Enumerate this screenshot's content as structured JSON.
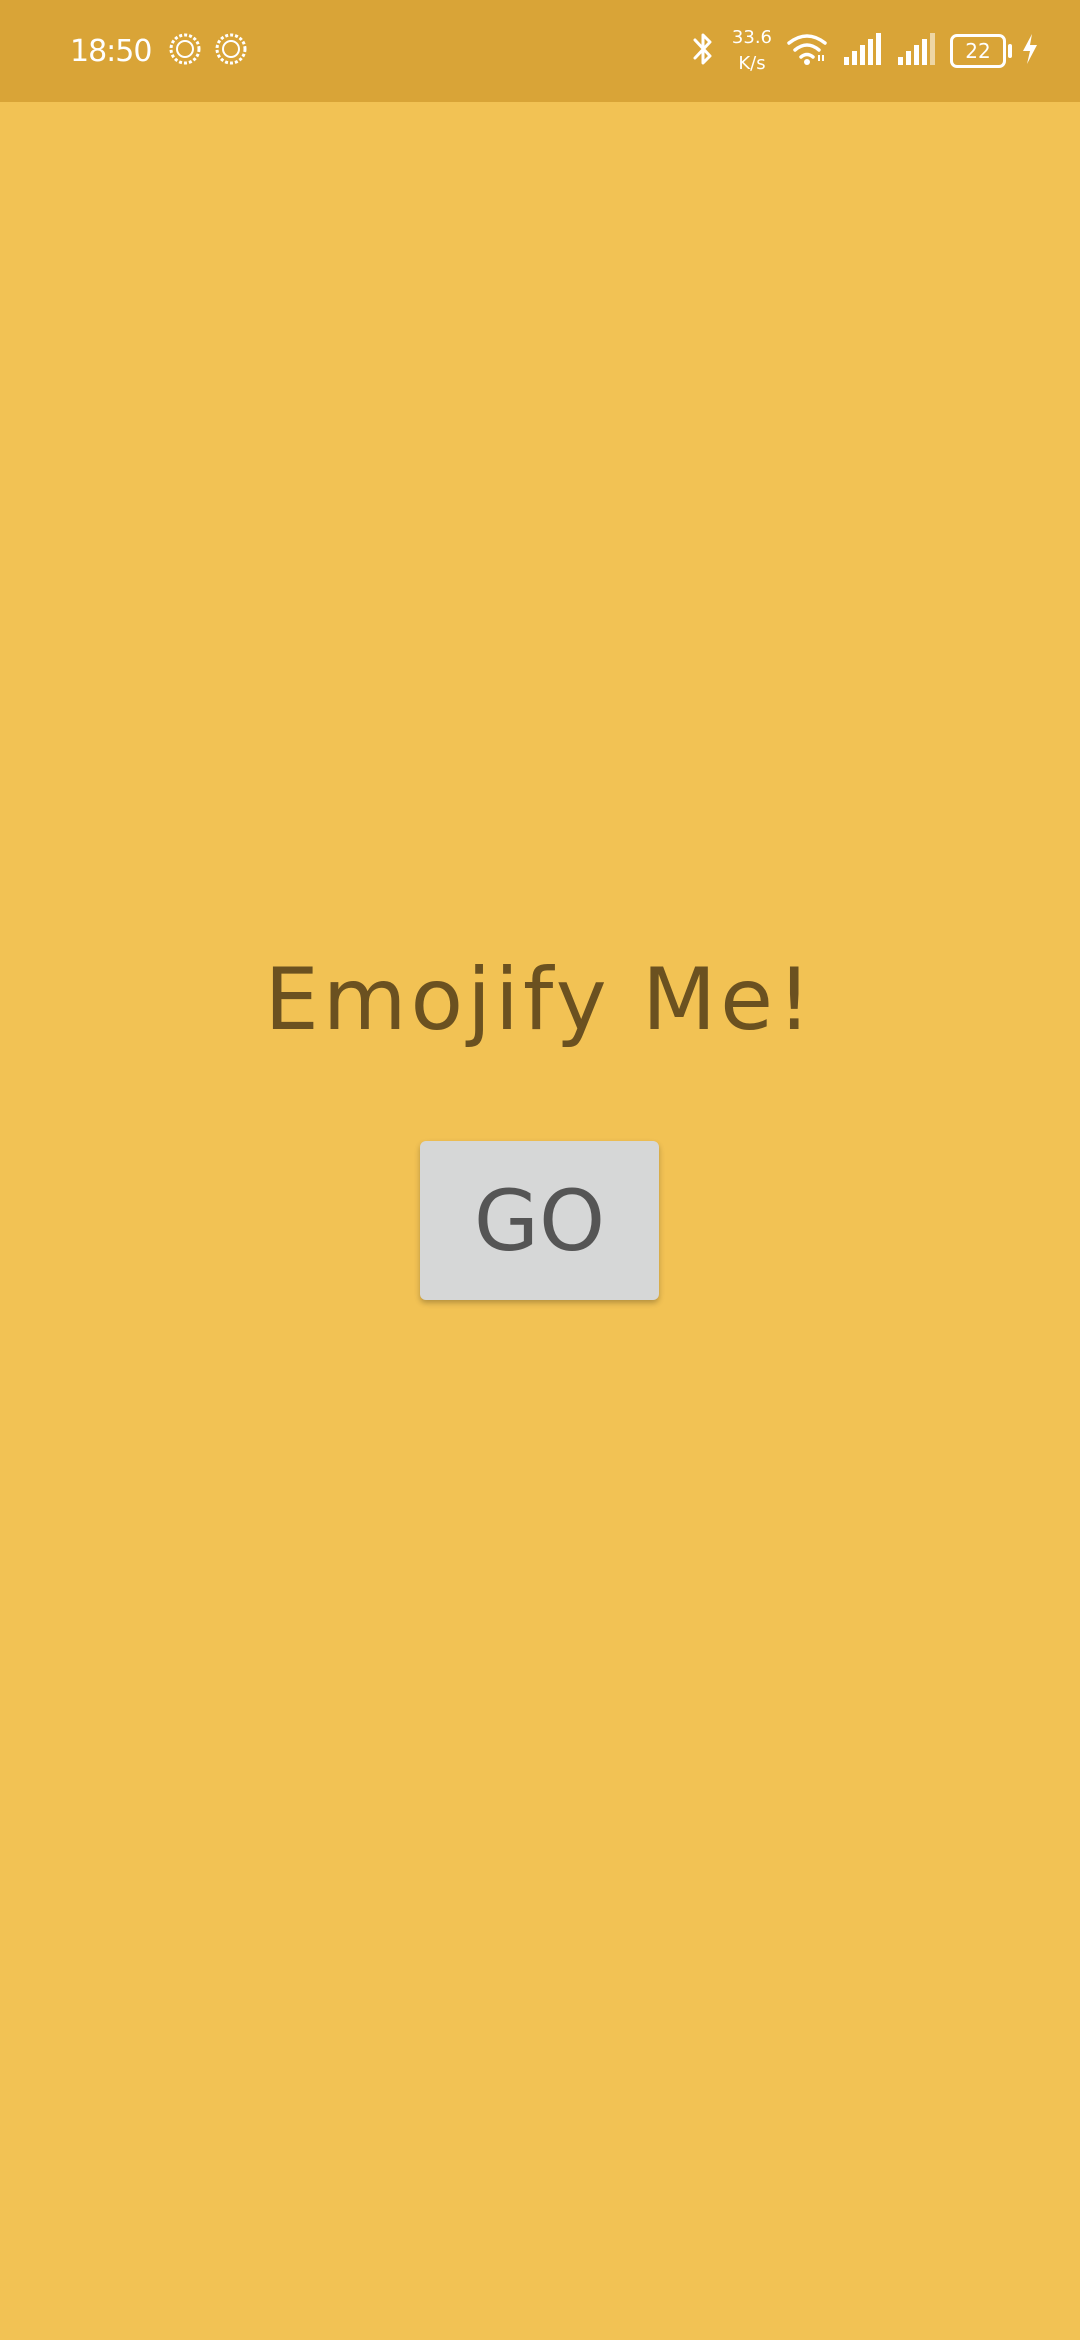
{
  "status_bar": {
    "time": "18:50",
    "left_icons": [
      "sync-status-icon",
      "sync-status-icon"
    ],
    "net_speed_value": "33.6",
    "net_speed_unit": "K/s",
    "battery_level": "22",
    "right_icons": [
      "bluetooth-icon",
      "wifi-icon",
      "signal-icon",
      "signal-icon",
      "charging-icon"
    ]
  },
  "main": {
    "title": "Emojify Me!",
    "go_button_label": "GO"
  },
  "colors": {
    "background": "#F2C254",
    "status_bar": "#D9A437",
    "title_text": "#6B5120",
    "button_bg": "#D6D7D7",
    "button_text": "#555555"
  }
}
